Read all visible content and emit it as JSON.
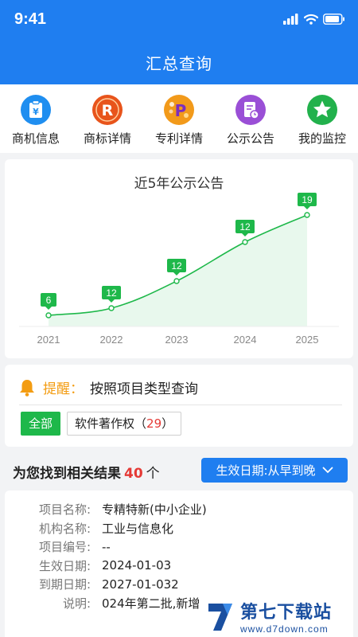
{
  "status_bar": {
    "time": "9:41"
  },
  "header": {
    "title": "汇总查询"
  },
  "quick_nav": [
    {
      "label": "商机信息",
      "icon": "briefcase-icon",
      "color": "#1f8ef0"
    },
    {
      "label": "商标详情",
      "icon": "trademark-r-icon",
      "color": "#e8541b"
    },
    {
      "label": "专利详情",
      "icon": "patent-p-icon",
      "color": "#f29a1a"
    },
    {
      "label": "公示公告",
      "icon": "announcement-icon",
      "color": "#9a4fd6"
    },
    {
      "label": "我的监控",
      "icon": "star-icon",
      "color": "#22b14c"
    }
  ],
  "chart_data": {
    "type": "area",
    "title": "近5年公示公告",
    "categories": [
      "2021",
      "2022",
      "2023",
      "2024",
      "2025"
    ],
    "values": [
      6,
      12,
      12,
      12,
      19
    ],
    "data_labels": [
      "6",
      "12",
      "12",
      "12",
      "19"
    ],
    "color": "#1eb84a",
    "grid": false
  },
  "reminder": {
    "label": "提醒：",
    "text": "按照项目类型查询"
  },
  "filters": {
    "all_label": "全部",
    "category_label": "软件著作权（",
    "category_count": "29",
    "category_suffix": "）"
  },
  "results": {
    "prefix": "为您找到相关结果",
    "count": "40",
    "unit": "个",
    "sort_label": "生效日期:从早到晚"
  },
  "item": {
    "fields": [
      {
        "k": "项目名称:",
        "v": "专精特新(中小企业)"
      },
      {
        "k": "机构名称:",
        "v": "工业与信息化"
      },
      {
        "k": "项目编号:",
        "v": "--"
      },
      {
        "k": "生效日期:",
        "v": "2024-01-03"
      },
      {
        "k": "到期日期:",
        "v": "2027-01-032"
      },
      {
        "k": "说明:",
        "v": "024年第二批,新增"
      }
    ]
  },
  "watermark": {
    "title": "第七下载站",
    "url": "www.d7down.com"
  }
}
